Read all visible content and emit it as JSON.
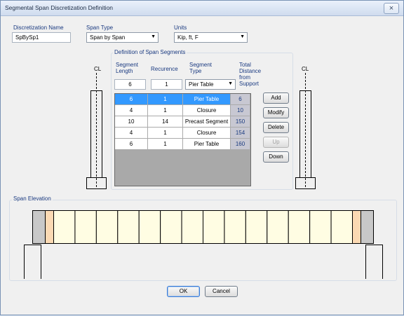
{
  "window": {
    "title": "Segmental Span Discretization Definition",
    "close_glyph": "×"
  },
  "fields": {
    "name_label": "Discretization Name",
    "name_value": "SpBySp1",
    "span_type_label": "Span Type",
    "span_type_value": "Span by Span",
    "units_label": "Units",
    "units_value": "Kip, ft, F"
  },
  "segments_group": {
    "title": "Definition of Span Segments",
    "col_length": "Segment Length",
    "col_recurrence": "Recurence",
    "col_type": "Segment Type",
    "col_total": "Total Distance from Support",
    "input_length": "6",
    "input_recurrence": "1",
    "input_type": "Pier Table",
    "rows": [
      {
        "length": "6",
        "recurrence": "1",
        "type": "Pier Table",
        "total": "6",
        "selected": true
      },
      {
        "length": "4",
        "recurrence": "1",
        "type": "Closure",
        "total": "10"
      },
      {
        "length": "10",
        "recurrence": "14",
        "type": "Precast Segment",
        "total": "150"
      },
      {
        "length": "4",
        "recurrence": "1",
        "type": "Closure",
        "total": "154"
      },
      {
        "length": "6",
        "recurrence": "1",
        "type": "Pier Table",
        "total": "160"
      }
    ],
    "buttons": {
      "add": "Add",
      "modify": "Modify",
      "delete": "Delete",
      "up": "Up",
      "down": "Down"
    }
  },
  "cl_label": "CL",
  "elevation": {
    "title": "Span Elevation"
  },
  "footer": {
    "ok": "OK",
    "cancel": "Cancel"
  }
}
